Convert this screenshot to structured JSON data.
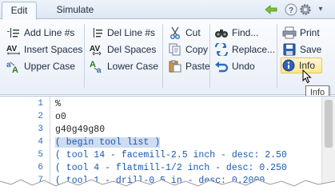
{
  "tabs": [
    {
      "label": "Edit",
      "active": true
    },
    {
      "label": "Simulate",
      "active": false
    }
  ],
  "title_icons": [
    "back-arrow-icon",
    "help-icon",
    "gear-icon",
    "chevron-down-icon"
  ],
  "ribbon": {
    "groups": [
      {
        "buttons": [
          {
            "label": "Add Line #s",
            "icon": "add-line-numbers-icon"
          },
          {
            "label": "Insert Spaces",
            "icon": "insert-spaces-icon"
          },
          {
            "label": "Upper Case",
            "icon": "upper-case-icon"
          }
        ]
      },
      {
        "buttons": [
          {
            "label": "Del Line #s",
            "icon": "delete-line-numbers-icon"
          },
          {
            "label": "Del Spaces",
            "icon": "delete-spaces-icon"
          },
          {
            "label": "Lower Case",
            "icon": "lower-case-icon"
          }
        ]
      },
      {
        "buttons": [
          {
            "label": "Cut",
            "icon": "scissors-icon"
          },
          {
            "label": "Copy",
            "icon": "copy-icon"
          },
          {
            "label": "Paste",
            "icon": "paste-icon"
          }
        ]
      },
      {
        "buttons": [
          {
            "label": "Find...",
            "icon": "binoculars-icon"
          },
          {
            "label": "Replace...",
            "icon": "replace-icon"
          },
          {
            "label": "Undo",
            "icon": "undo-icon"
          }
        ]
      },
      {
        "buttons": [
          {
            "label": "Print",
            "icon": "printer-icon"
          },
          {
            "label": "Save",
            "icon": "save-icon"
          },
          {
            "label": "Info",
            "icon": "info-icon",
            "hovered": true
          }
        ]
      }
    ]
  },
  "tooltip": {
    "text": "Info"
  },
  "editor": {
    "lines": [
      {
        "num": "1",
        "text": "%"
      },
      {
        "num": "2",
        "text": "o0"
      },
      {
        "num": "3",
        "text": "g40g49g80"
      },
      {
        "num": "4",
        "text": "( begin tool list )",
        "highlighted": true
      },
      {
        "num": "5",
        "text": "( tool 14 - facemill-2.5 inch - desc: 2.50"
      },
      {
        "num": "6",
        "text": "( tool 4 - flatmill-1/2 inch - desc: 0.250"
      },
      {
        "num": "7",
        "text": "( tool 1 - drill-0.5 in - desc: 0.2000"
      }
    ]
  },
  "colors": {
    "line_number": "#2b6cbf",
    "comment": "#1a58b3",
    "highlight": "#cfdcf1",
    "hover_fill": "#ffe78e"
  }
}
